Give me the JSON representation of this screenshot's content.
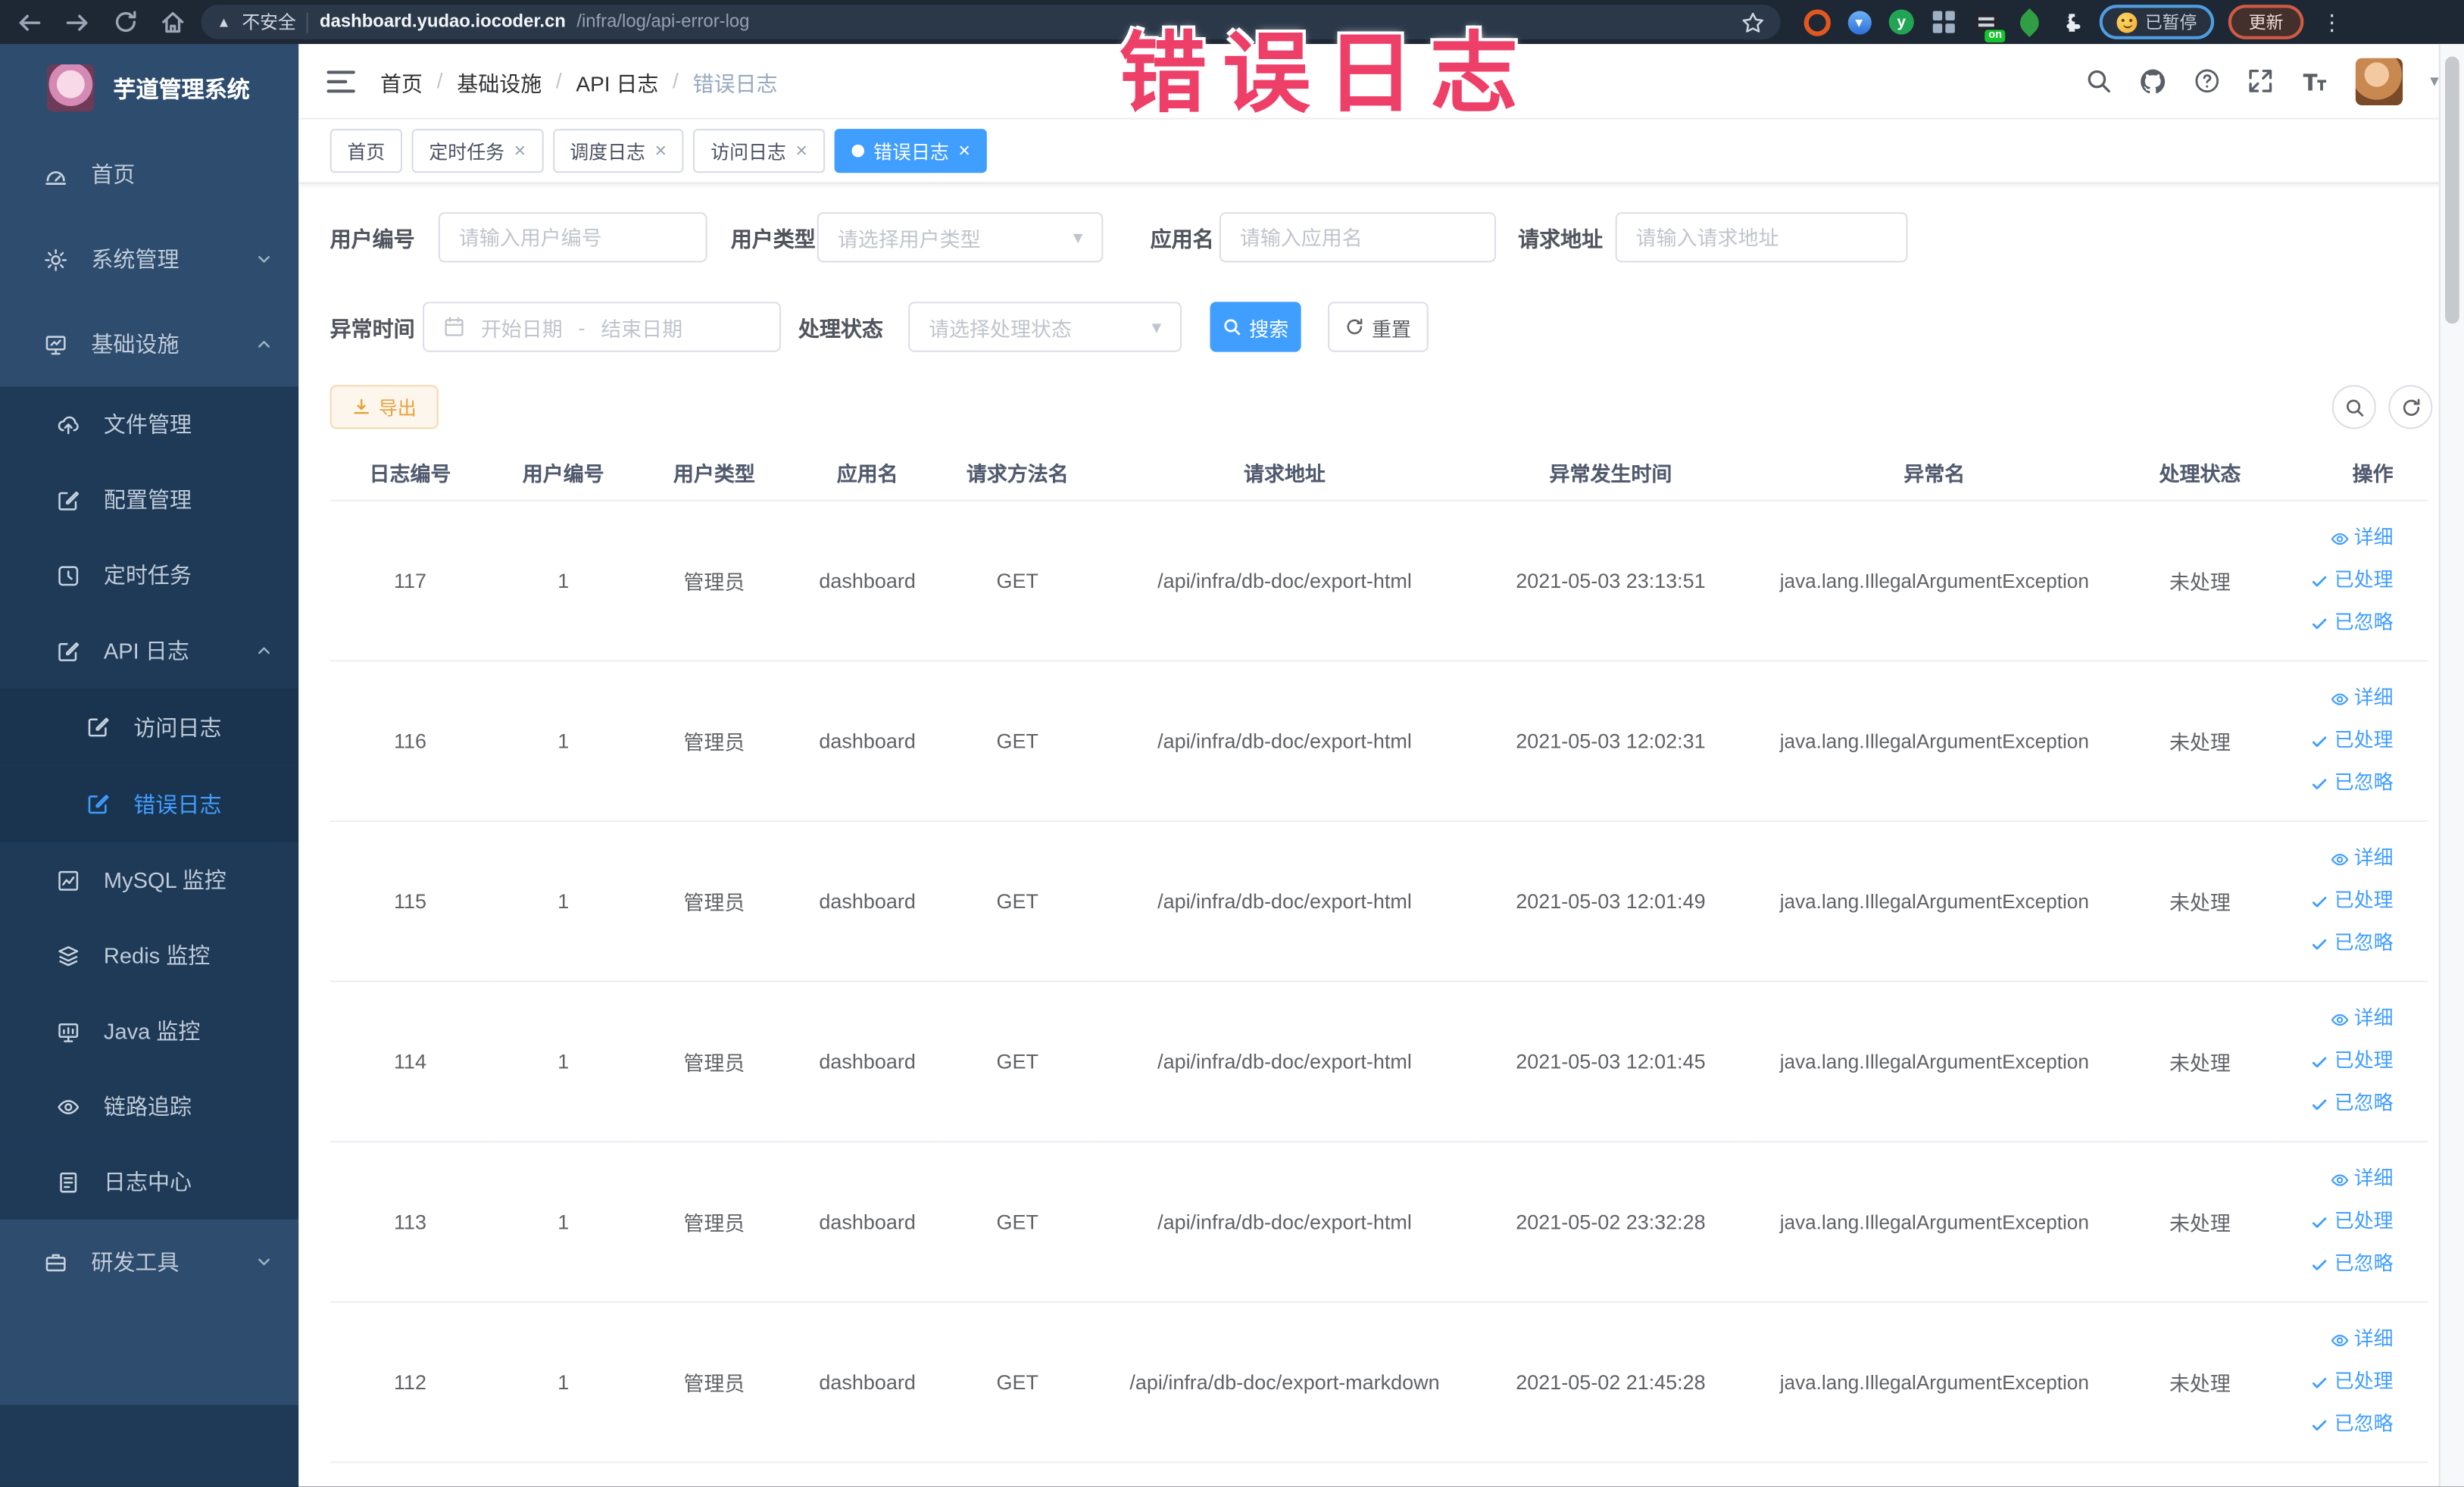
{
  "browser": {
    "security_label": "不安全",
    "url_host": "dashboard.yudao.iocoder.cn",
    "url_path": "/infra/log/api-error-log",
    "extension_letter": "y",
    "extension_on_badge": "on",
    "paused_pill": "已暂停",
    "update_pill": "更新"
  },
  "overlay": {
    "title": "错误日志"
  },
  "sidebar": {
    "logo_title": "芋道管理系统",
    "items": [
      {
        "label": "首页"
      },
      {
        "label": "系统管理"
      },
      {
        "label": "基础设施"
      },
      {
        "label": "文件管理"
      },
      {
        "label": "配置管理"
      },
      {
        "label": "定时任务"
      },
      {
        "label": "API 日志"
      },
      {
        "label": "访问日志"
      },
      {
        "label": "错误日志"
      },
      {
        "label": "MySQL 监控"
      },
      {
        "label": "Redis 监控"
      },
      {
        "label": "Java 监控"
      },
      {
        "label": "链路追踪"
      },
      {
        "label": "日志中心"
      },
      {
        "label": "研发工具"
      }
    ]
  },
  "header": {
    "breadcrumb": [
      "首页",
      "基础设施",
      "API 日志",
      "错误日志"
    ]
  },
  "tabs": [
    {
      "label": "首页",
      "closable": false,
      "active": false
    },
    {
      "label": "定时任务",
      "closable": true,
      "active": false
    },
    {
      "label": "调度日志",
      "closable": true,
      "active": false
    },
    {
      "label": "访问日志",
      "closable": true,
      "active": false
    },
    {
      "label": "错误日志",
      "closable": true,
      "active": true
    }
  ],
  "filters": {
    "user_no": {
      "label": "用户编号",
      "placeholder": "请输入用户编号"
    },
    "user_type": {
      "label": "用户类型",
      "placeholder": "请选择用户类型"
    },
    "app_name": {
      "label": "应用名",
      "placeholder": "请输入应用名"
    },
    "request_url": {
      "label": "请求地址",
      "placeholder": "请输入请求地址"
    },
    "exception_time": {
      "label": "异常时间",
      "start_placeholder": "开始日期",
      "separator": "-",
      "end_placeholder": "结束日期"
    },
    "process_status": {
      "label": "处理状态",
      "placeholder": "请选择处理状态"
    },
    "search_label": "搜索",
    "reset_label": "重置"
  },
  "toolbar": {
    "export_label": "导出"
  },
  "table": {
    "columns": [
      "日志编号",
      "用户编号",
      "用户类型",
      "应用名",
      "请求方法名",
      "请求地址",
      "异常发生时间",
      "异常名",
      "处理状态",
      "操作"
    ],
    "row_actions": [
      "详细",
      "已处理",
      "已忽略"
    ],
    "rows": [
      {
        "id": "117",
        "user_id": "1",
        "user_type": "管理员",
        "app": "dashboard",
        "method": "GET",
        "url": "/api/infra/db-doc/export-html",
        "time": "2021-05-03 23:13:51",
        "exception": "java.lang.IllegalArgumentException",
        "status": "未处理"
      },
      {
        "id": "116",
        "user_id": "1",
        "user_type": "管理员",
        "app": "dashboard",
        "method": "GET",
        "url": "/api/infra/db-doc/export-html",
        "time": "2021-05-03 12:02:31",
        "exception": "java.lang.IllegalArgumentException",
        "status": "未处理"
      },
      {
        "id": "115",
        "user_id": "1",
        "user_type": "管理员",
        "app": "dashboard",
        "method": "GET",
        "url": "/api/infra/db-doc/export-html",
        "time": "2021-05-03 12:01:49",
        "exception": "java.lang.IllegalArgumentException",
        "status": "未处理"
      },
      {
        "id": "114",
        "user_id": "1",
        "user_type": "管理员",
        "app": "dashboard",
        "method": "GET",
        "url": "/api/infra/db-doc/export-html",
        "time": "2021-05-03 12:01:45",
        "exception": "java.lang.IllegalArgumentException",
        "status": "未处理"
      },
      {
        "id": "113",
        "user_id": "1",
        "user_type": "管理员",
        "app": "dashboard",
        "method": "GET",
        "url": "/api/infra/db-doc/export-html",
        "time": "2021-05-02 23:32:28",
        "exception": "java.lang.IllegalArgumentException",
        "status": "未处理"
      },
      {
        "id": "112",
        "user_id": "1",
        "user_type": "管理员",
        "app": "dashboard",
        "method": "GET",
        "url": "/api/infra/db-doc/export-markdown",
        "time": "2021-05-02 21:45:28",
        "exception": "java.lang.IllegalArgumentException",
        "status": "未处理"
      }
    ]
  },
  "icons": {
    "breadcrumb_separator": "/",
    "select_caret": "▾",
    "menu_dots": "⋮",
    "warning_glyph": "▲",
    "close_glyph": "×"
  },
  "colors": {
    "primary": "#409eff",
    "warning": "#e6a23c",
    "overlay_pink": "#ee3f68",
    "sidebar_bg": "#2e4c6e",
    "submenu_bg": "#1e3a57",
    "chrome_bg": "#1e2734"
  }
}
